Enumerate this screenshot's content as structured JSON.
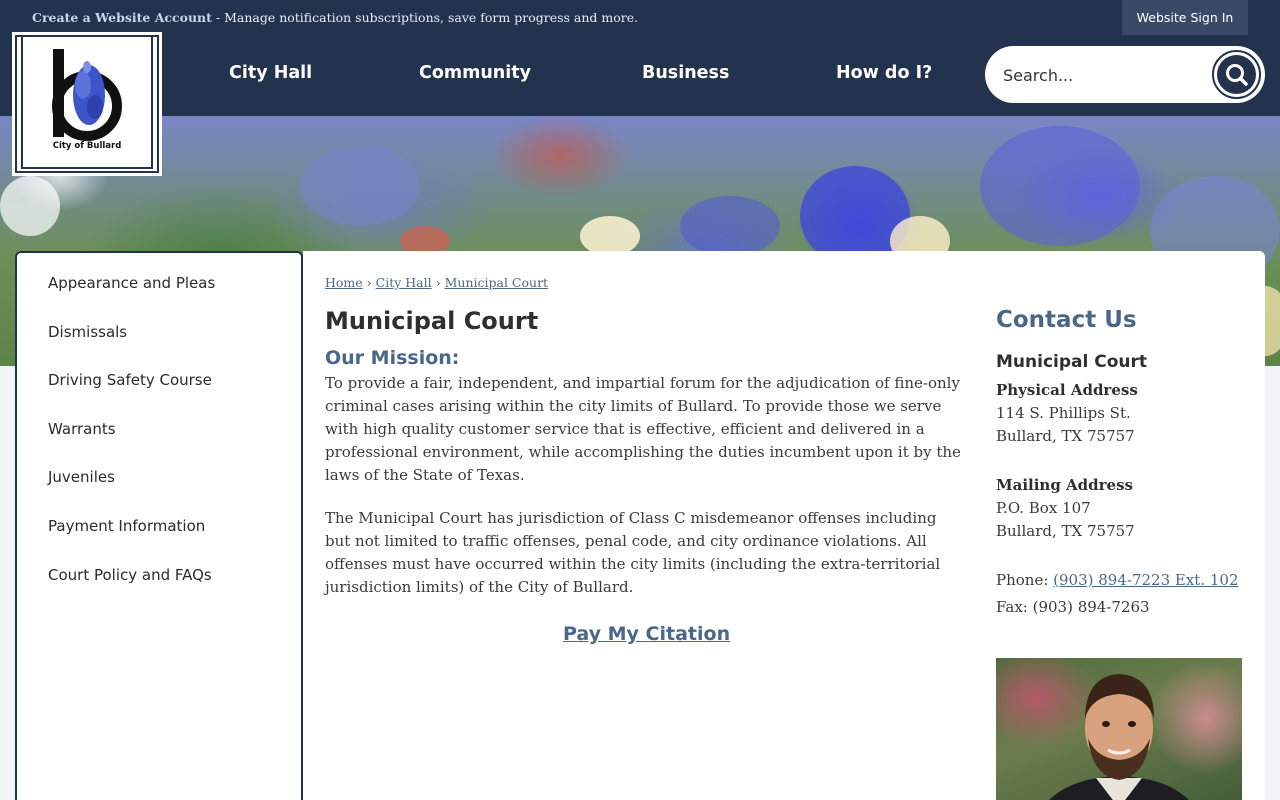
{
  "topbar": {
    "create_account_link": "Create a Website Account",
    "create_account_desc": " - Manage notification subscriptions, save form progress and more.",
    "sign_in": "Website Sign In"
  },
  "logo": {
    "caption": "City of Bullard"
  },
  "nav": {
    "items": [
      "City Hall",
      "Community",
      "Business",
      "How do I?"
    ],
    "search_placeholder": "Search...",
    "search_icon": "search-icon"
  },
  "sidebar": {
    "items": [
      "Appearance and Pleas",
      "Dismissals",
      "Driving Safety Course",
      "Warrants",
      "Juveniles",
      "Payment Information",
      "Court Policy and FAQs"
    ]
  },
  "breadcrumb": {
    "home": "Home",
    "city_hall": "City Hall",
    "current": "Municipal Court"
  },
  "main": {
    "title": "Municipal Court",
    "mission_heading": "Our Mission:",
    "mission_text": "To provide a fair, independent, and impartial forum for the adjudication of fine-only criminal cases arising within the city limits of Bullard. To provide those we serve with high quality customer service that is effective, efficient and delivered in a professional environment, while accomplishing the duties incumbent upon it by the laws of the State of Texas.",
    "jurisdiction_text": "The Municipal Court has jurisdiction of Class C misdemeanor offenses including but not limited to traffic offenses, penal code, and city ordinance violations. All offenses must have occurred within the city limits (including the extra-territorial jurisdiction limits) of the City of Bullard.",
    "pay_link": "Pay My Citation"
  },
  "contact": {
    "title": "Contact Us",
    "dept": "Municipal Court",
    "physical_heading": "Physical Address",
    "physical_line1": "114 S. Phillips St.",
    "physical_line2": "Bullard, TX 75757",
    "mailing_heading": "Mailing Address",
    "mailing_line1": "P.O. Box 107",
    "mailing_line2": "Bullard, TX 75757",
    "phone_label": "Phone: ",
    "phone": "(903) 894-7223 Ext. 102",
    "fax": "Fax: (903) 894-7263"
  },
  "colors": {
    "navy": "#23324d",
    "link": "#4a6787"
  }
}
